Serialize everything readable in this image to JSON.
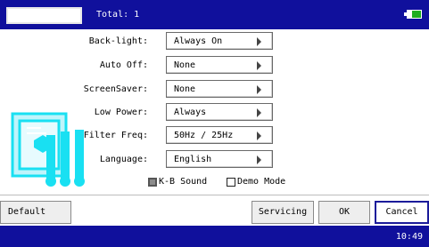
{
  "header": {
    "name_value": "",
    "total_text": "Total: 1",
    "battery_level": 0.55
  },
  "settings": [
    {
      "label": "Back-light:",
      "value": "Always On"
    },
    {
      "label": "Auto Off:",
      "value": "None"
    },
    {
      "label": "ScreenSaver:",
      "value": "None"
    },
    {
      "label": "Low Power:",
      "value": "Always"
    },
    {
      "label": "Filter Freq:",
      "value": "50Hz / 25Hz"
    },
    {
      "label": "Language:",
      "value": "English"
    }
  ],
  "checkboxes": [
    {
      "label": "K-B Sound",
      "checked": true
    },
    {
      "label": "Demo Mode",
      "checked": false
    }
  ],
  "buttons": {
    "default": "Default",
    "servicing": "Servicing",
    "ok": "OK",
    "cancel": "Cancel"
  },
  "status": {
    "time": "10:49"
  },
  "colors": {
    "bar": "#10109c",
    "illustration": "#19e0f2",
    "battery": "#1fae1f"
  }
}
